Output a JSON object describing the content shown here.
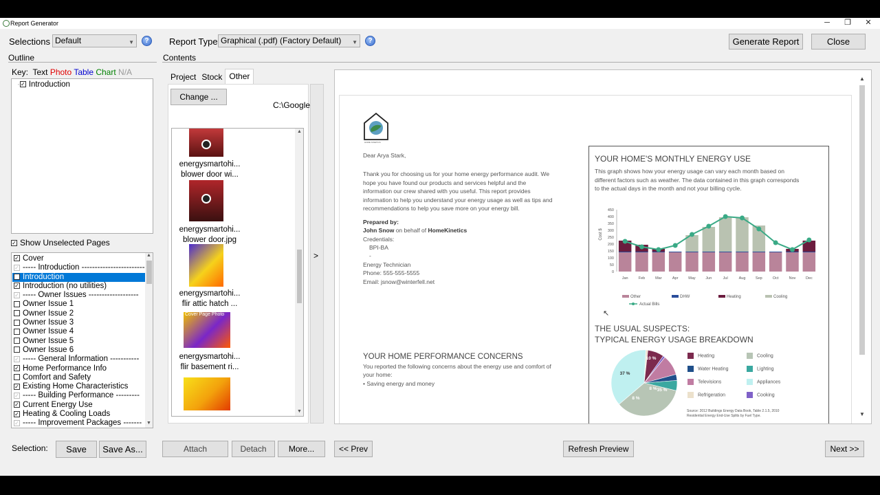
{
  "window": {
    "title": "Report Generator",
    "min": "─",
    "max": "❐",
    "close": "✕"
  },
  "top": {
    "selections_label": "Selections",
    "selections_value": "Default",
    "report_type_label": "Report Type",
    "report_type_value": "Graphical (.pdf) (Factory Default)",
    "generate": "Generate Report",
    "close": "Close"
  },
  "outline": {
    "label": "Outline",
    "key": "Key:",
    "key_text": "Text",
    "key_photo": "Photo",
    "key_table": "Table",
    "key_chart": "Chart",
    "key_na": "N/A",
    "tree_item": "Introduction",
    "show_unselected": "Show Unselected Pages"
  },
  "pages": [
    {
      "label": "Cover",
      "checked": true,
      "dim": false
    },
    {
      "label": "----- Introduction -------------------------",
      "checked": true,
      "dim": true
    },
    {
      "label": "Introduction",
      "checked": true,
      "dim": false,
      "selected": true
    },
    {
      "label": "Introduction (no utilities)",
      "checked": true,
      "dim": false
    },
    {
      "label": "----- Owner Issues -------------------",
      "checked": true,
      "dim": true
    },
    {
      "label": "Owner Issue 1",
      "checked": false,
      "dim": false
    },
    {
      "label": "Owner Issue 2",
      "checked": false,
      "dim": false
    },
    {
      "label": "Owner Issue 3",
      "checked": false,
      "dim": false
    },
    {
      "label": "Owner Issue 4",
      "checked": false,
      "dim": false
    },
    {
      "label": "Owner Issue 5",
      "checked": false,
      "dim": false
    },
    {
      "label": "Owner Issue 6",
      "checked": false,
      "dim": false
    },
    {
      "label": "----- General Information -----------",
      "checked": true,
      "dim": true
    },
    {
      "label": "Home Performance Info",
      "checked": true,
      "dim": false
    },
    {
      "label": "Comfort and Safety",
      "checked": false,
      "dim": false
    },
    {
      "label": "Existing Home Characteristics",
      "checked": true,
      "dim": false
    },
    {
      "label": "----- Building Performance ---------",
      "checked": true,
      "dim": true
    },
    {
      "label": "Current Energy Use",
      "checked": true,
      "dim": false
    },
    {
      "label": "Heating & Cooling Loads",
      "checked": true,
      "dim": false
    },
    {
      "label": "----- Improvement Packages -------",
      "checked": true,
      "dim": true
    }
  ],
  "selection": {
    "label": "Selection:",
    "save": "Save",
    "save_as": "Save As..."
  },
  "contents": {
    "label": "Contents",
    "tabs": [
      "Project",
      "Stock",
      "Other"
    ],
    "active_tab": "Other",
    "change": "Change ...",
    "path": "C:\\Google",
    "arrow": ">"
  },
  "photos": [
    {
      "line1": "energysmartohi...",
      "line2": "blower door wi...",
      "colors": [
        "#c2393b",
        "#e8d7cf",
        "#5a1212"
      ]
    },
    {
      "line1": "energysmartohi...",
      "line2": "blower door.jpg",
      "colors": [
        "#b0262a",
        "#dcd5cf",
        "#3a1010"
      ]
    },
    {
      "line1": "energysmartohi...",
      "line2": "flir attic hatch ...",
      "colors": [
        "#4b2bd0",
        "#f6d21b",
        "#ff6a00"
      ]
    },
    {
      "line1": "energysmartohi...",
      "line2": "flir basement ri...",
      "overlay": "Cover Page Photo",
      "colors": [
        "#f0c000",
        "#7a27c8",
        "#ff5a00"
      ]
    },
    {
      "line1": "",
      "line2": "",
      "colors": [
        "#f7e01a",
        "#f3a10c",
        "#e33b00"
      ]
    }
  ],
  "bottom": {
    "attach": "Attach",
    "detach": "Detach",
    "more": "More...",
    "prev": "<< Prev",
    "refresh": "Refresh Preview",
    "next": "Next >>"
  },
  "doc": {
    "logo_caption": "HOME KINETICS",
    "greeting": "Dear Arya Stark,",
    "intro": [
      "Thank you for choosing us for your home energy performance audit. We",
      "hope you have found our products and services helpful and the",
      "information our crew shared with you useful. This report provides",
      "information to help you understand your energy usage as well as tips and",
      "recommendations to help you save more on your energy bill."
    ],
    "prepared_by": "Prepared by:",
    "preparer_name": "John Snow",
    "preparer_on_behalf": " on behalf of ",
    "company": "HomeKinetics",
    "credentials": "Credentials:",
    "cred1": "BPI-BA",
    "cred2": "-",
    "role": "Energy Technician",
    "phone": "Phone: 555-555-5555",
    "email": "Email: jsnow@winterfell.net",
    "concerns_title": "YOUR HOME PERFORMANCE CONCERNS",
    "concerns_text1": "You reported the following concerns about the energy use and comfort of",
    "concerns_text2": "your home:",
    "concern1": "• Saving energy and money",
    "monthly_title": "YOUR HOME'S MONTHLY ENERGY USE",
    "monthly_text": [
      "This graph shows how your energy usage can vary each month based on",
      "different factors such as weather. The data contained in this graph corresponds",
      "to the actual days in the month and not your billing cycle."
    ],
    "suspects_title1": "THE USUAL SUSPECTS:",
    "suspects_title2": "TYPICAL ENERGY USAGE BREAKDOWN",
    "source1": "Source: 2012 Buildings Energy Data Book, Table 2.1.5, 2010",
    "source2": "Residential Energy End-Use Splits by Fuel Type."
  },
  "chart_data": [
    {
      "type": "bar",
      "ylabel": "Cost $",
      "ylim": [
        0,
        450
      ],
      "yticks": [
        0,
        50,
        100,
        150,
        200,
        250,
        300,
        350,
        400,
        450
      ],
      "categories": [
        "Jan",
        "Feb",
        "Mar",
        "Apr",
        "May",
        "Jun",
        "Jul",
        "Aug",
        "Sep",
        "Oct",
        "Nov",
        "Dec"
      ],
      "series": [
        {
          "name": "Other",
          "color": "#b9849a",
          "values": [
            140,
            140,
            140,
            140,
            140,
            140,
            140,
            140,
            140,
            140,
            140,
            140
          ]
        },
        {
          "name": "DHW",
          "color": "#2a4d9a",
          "values": [
            5,
            5,
            5,
            5,
            5,
            5,
            5,
            5,
            5,
            5,
            5,
            5
          ]
        },
        {
          "name": "Heating",
          "color": "#6b1c3e",
          "values": [
            80,
            50,
            20,
            0,
            0,
            0,
            0,
            0,
            0,
            0,
            20,
            80
          ]
        },
        {
          "name": "Cooling",
          "color": "#b9c2b1",
          "values": [
            0,
            0,
            0,
            0,
            120,
            180,
            250,
            250,
            190,
            0,
            0,
            0
          ]
        }
      ],
      "line": {
        "name": "Actual Bills",
        "color": "#3aaa86",
        "values": [
          220,
          180,
          160,
          190,
          270,
          330,
          400,
          390,
          310,
          210,
          160,
          230
        ]
      }
    },
    {
      "type": "pie",
      "series": [
        {
          "name": "Heating",
          "color": "#7c2a4e",
          "value": 8
        },
        {
          "name": "Cooling",
          "color": "#b7c5b5",
          "value": 35
        },
        {
          "name": "Water Heating",
          "color": "#1f4f8a",
          "value": 3
        },
        {
          "name": "Lighting",
          "color": "#3aa8a0",
          "value": 5
        },
        {
          "name": "Televisions",
          "color": "#c07ca2",
          "value": 10
        },
        {
          "name": "Appliances",
          "color": "#bff0f0",
          "value": 37
        },
        {
          "name": "Refrigeration",
          "color": "#ece1cc",
          "value": 1
        },
        {
          "name": "Cooking",
          "color": "#7f61c8",
          "value": 1
        }
      ],
      "labels": [
        "10 %",
        "8 %",
        "35 %",
        "37 %",
        "8 %"
      ]
    }
  ]
}
